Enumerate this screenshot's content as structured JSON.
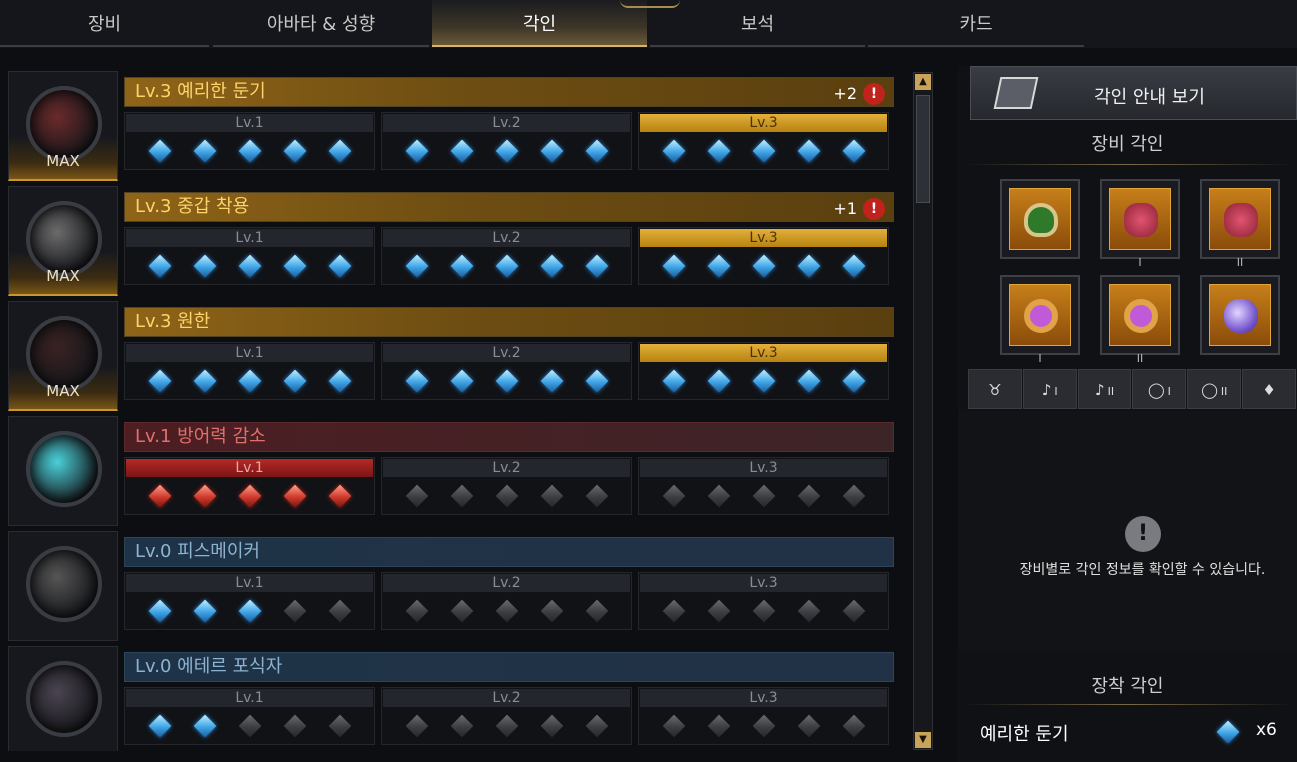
{
  "tabs": [
    {
      "label": "장비",
      "active": false
    },
    {
      "label": "아바타 & 성향",
      "active": false
    },
    {
      "label": "각인",
      "active": true
    },
    {
      "label": "보석",
      "active": false
    },
    {
      "label": "카드",
      "active": false
    }
  ],
  "engravings": [
    {
      "name": "Lv.3 예리한 둔기",
      "style": "gold",
      "max": true,
      "max_label": "MAX",
      "bonus": "+2",
      "warning": "!",
      "active_level": 3,
      "level_color": "gold",
      "levels": [
        {
          "label": "Lv.1",
          "gems": [
            "b",
            "b",
            "b",
            "b",
            "b"
          ]
        },
        {
          "label": "Lv.2",
          "gems": [
            "b",
            "b",
            "b",
            "b",
            "b"
          ]
        },
        {
          "label": "Lv.3",
          "gems": [
            "b",
            "b",
            "b",
            "b",
            "b"
          ]
        }
      ]
    },
    {
      "name": "Lv.3 중갑 착용",
      "style": "gold",
      "max": true,
      "max_label": "MAX",
      "bonus": "+1",
      "warning": "!",
      "active_level": 3,
      "level_color": "gold",
      "levels": [
        {
          "label": "Lv.1",
          "gems": [
            "b",
            "b",
            "b",
            "b",
            "b"
          ]
        },
        {
          "label": "Lv.2",
          "gems": [
            "b",
            "b",
            "b",
            "b",
            "b"
          ]
        },
        {
          "label": "Lv.3",
          "gems": [
            "b",
            "b",
            "b",
            "b",
            "b"
          ]
        }
      ]
    },
    {
      "name": "Lv.3 원한",
      "style": "gold",
      "max": true,
      "max_label": "MAX",
      "bonus": "",
      "warning": "",
      "active_level": 3,
      "level_color": "gold",
      "levels": [
        {
          "label": "Lv.1",
          "gems": [
            "b",
            "b",
            "b",
            "b",
            "b"
          ]
        },
        {
          "label": "Lv.2",
          "gems": [
            "b",
            "b",
            "b",
            "b",
            "b"
          ]
        },
        {
          "label": "Lv.3",
          "gems": [
            "b",
            "b",
            "b",
            "b",
            "b"
          ]
        }
      ]
    },
    {
      "name": "Lv.1 방어력 감소",
      "style": "red",
      "max": false,
      "max_label": "",
      "bonus": "",
      "warning": "",
      "active_level": 1,
      "level_color": "red",
      "levels": [
        {
          "label": "Lv.1",
          "gems": [
            "r",
            "r",
            "r",
            "r",
            "r"
          ]
        },
        {
          "label": "Lv.2",
          "gems": [
            "g",
            "g",
            "g",
            "g",
            "g"
          ]
        },
        {
          "label": "Lv.3",
          "gems": [
            "g",
            "g",
            "g",
            "g",
            "g"
          ]
        }
      ]
    },
    {
      "name": "Lv.0 피스메이커",
      "style": "blue",
      "max": false,
      "max_label": "",
      "bonus": "",
      "warning": "",
      "active_level": 0,
      "level_color": "",
      "levels": [
        {
          "label": "Lv.1",
          "gems": [
            "b",
            "b",
            "b",
            "g",
            "g"
          ]
        },
        {
          "label": "Lv.2",
          "gems": [
            "g",
            "g",
            "g",
            "g",
            "g"
          ]
        },
        {
          "label": "Lv.3",
          "gems": [
            "g",
            "g",
            "g",
            "g",
            "g"
          ]
        }
      ]
    },
    {
      "name": "Lv.0 에테르 포식자",
      "style": "blue",
      "max": false,
      "max_label": "",
      "bonus": "",
      "warning": "",
      "active_level": 0,
      "level_color": "",
      "levels": [
        {
          "label": "Lv.1",
          "gems": [
            "b",
            "b",
            "g",
            "g",
            "g"
          ]
        },
        {
          "label": "Lv.2",
          "gems": [
            "g",
            "g",
            "g",
            "g",
            "g"
          ]
        },
        {
          "label": "Lv.3",
          "gems": [
            "g",
            "g",
            "g",
            "g",
            "g"
          ]
        }
      ]
    }
  ],
  "orb_colors": [
    "#6b2a2a",
    "#6b6b6b",
    "#3a2222",
    "#4ad0d8",
    "#555555",
    "#4a4450"
  ],
  "right": {
    "guide_label": "각인 안내 보기",
    "equip_section": "장비 각인",
    "slots": [
      {
        "icon": "necklace-icon",
        "roman": ""
      },
      {
        "icon": "earring-icon",
        "roman": "I"
      },
      {
        "icon": "earring-icon",
        "roman": "II"
      },
      {
        "icon": "ring-icon",
        "roman": "I"
      },
      {
        "icon": "ring-icon",
        "roman": "II"
      },
      {
        "icon": "ability-stone-icon",
        "roman": ""
      }
    ],
    "filter_tabs": [
      {
        "icon": "necklace-icon",
        "roman": ""
      },
      {
        "icon": "earring-icon",
        "roman": "I"
      },
      {
        "icon": "earring-icon",
        "roman": "II"
      },
      {
        "icon": "ring-icon",
        "roman": "I"
      },
      {
        "icon": "ring-icon",
        "roman": "II"
      },
      {
        "icon": "stone-icon",
        "roman": ""
      }
    ],
    "info_text": "장비별로 각인 정보를 확인할 수 있습니다.",
    "applied_section": "장착 각인",
    "applied": {
      "name": "예리한 둔기",
      "count": "x6"
    }
  },
  "colors": {
    "accent_gold": "#d9b56a",
    "warning_red": "#c0221c"
  }
}
